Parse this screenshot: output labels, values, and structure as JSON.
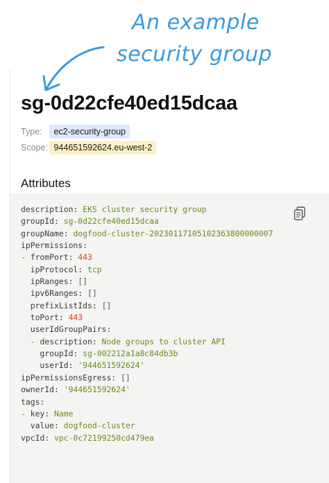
{
  "annotation": {
    "line1": "An example",
    "line2": "security group"
  },
  "resource": {
    "title": "sg-0d22cfe40ed15dcaa",
    "type_label": "Type:",
    "type_value": "ec2-security-group",
    "scope_label": "Scope:",
    "scope_value": "944651592624.eu-west-2"
  },
  "attributes": {
    "heading": "Attributes",
    "copy_icon": "clipboard-copy-icon",
    "lines": [
      [
        [
          "k",
          "description: "
        ],
        [
          "s",
          "EKS cluster security group"
        ]
      ],
      [
        [
          "k",
          "groupId: "
        ],
        [
          "s",
          "sg-0d22cfe40ed15dcaa"
        ]
      ],
      [
        [
          "k",
          "groupName: "
        ],
        [
          "s",
          "dogfood-cluster-20230117105102363800000007"
        ]
      ],
      [
        [
          "k",
          "ipPermissions:"
        ]
      ],
      [
        [
          "d",
          "- "
        ],
        [
          "k",
          "fromPort: "
        ],
        [
          "n",
          "443"
        ]
      ],
      [
        [
          "k",
          "  ipProtocol: "
        ],
        [
          "s",
          "tcp"
        ]
      ],
      [
        [
          "k",
          "  ipRanges: "
        ],
        [
          "p",
          "[]"
        ]
      ],
      [
        [
          "k",
          "  ipv6Ranges: "
        ],
        [
          "p",
          "[]"
        ]
      ],
      [
        [
          "k",
          "  prefixListIds: "
        ],
        [
          "p",
          "[]"
        ]
      ],
      [
        [
          "k",
          "  toPort: "
        ],
        [
          "n",
          "443"
        ]
      ],
      [
        [
          "k",
          "  userIdGroupPairs:"
        ]
      ],
      [
        [
          "k",
          "  "
        ],
        [
          "d",
          "- "
        ],
        [
          "k",
          "description: "
        ],
        [
          "s",
          "Node groups to cluster API"
        ]
      ],
      [
        [
          "k",
          "    groupId: "
        ],
        [
          "s",
          "sg-002212a1a8c84db3b"
        ]
      ],
      [
        [
          "k",
          "    userId: "
        ],
        [
          "s",
          "'944651592624'"
        ]
      ],
      [
        [
          "k",
          "ipPermissionsEgress: "
        ],
        [
          "p",
          "[]"
        ]
      ],
      [
        [
          "k",
          "ownerId: "
        ],
        [
          "s",
          "'944651592624'"
        ]
      ],
      [
        [
          "k",
          "tags:"
        ]
      ],
      [
        [
          "d",
          "- "
        ],
        [
          "k",
          "key: "
        ],
        [
          "s",
          "Name"
        ]
      ],
      [
        [
          "k",
          "  value: "
        ],
        [
          "s",
          "dogfood-cluster"
        ]
      ],
      [
        [
          "k",
          "vpcId: "
        ],
        [
          "s",
          "vpc-0c72199250cd479ea"
        ]
      ]
    ]
  },
  "colors": {
    "annotation": "#3a9ae0",
    "type_badge": "#dce8fb",
    "scope_badge": "#fbf2c4",
    "string": "#6a8a1f",
    "number": "#e0431b",
    "dash": "#e0431b",
    "code_bg": "#f4f4f2"
  }
}
